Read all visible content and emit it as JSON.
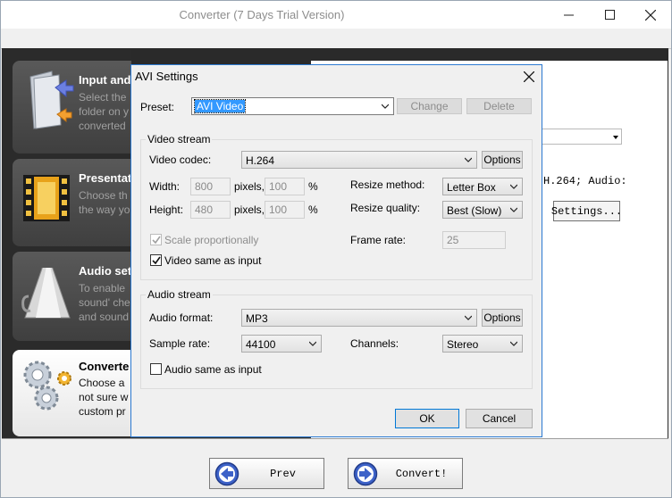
{
  "app": {
    "title": "Converter (7 Days Trial Version)"
  },
  "steps": [
    {
      "title": "Input and",
      "desc": [
        "Select the",
        "folder on y",
        "converted"
      ]
    },
    {
      "title": "Presentat",
      "desc": [
        "Choose th",
        "the way yo"
      ]
    },
    {
      "title": "Audio set",
      "desc": [
        "To enable",
        "sound' che",
        "and sound"
      ]
    },
    {
      "title": "Converte",
      "desc": [
        "Choose a",
        "not sure w",
        "custom pr"
      ]
    }
  ],
  "background": {
    "codec_text": "H.264; Audio:",
    "settings_label": "Settings..."
  },
  "nav": {
    "prev_label": "Prev",
    "convert_label": "Convert!"
  },
  "dialog": {
    "title": "AVI Settings",
    "preset_label": "Preset:",
    "preset_value": "AVI Video",
    "change_label": "Change",
    "delete_label": "Delete",
    "video": {
      "group_label": "Video stream",
      "codec_label": "Video codec:",
      "codec_value": "H.264",
      "options_label": "Options",
      "width_label": "Width:",
      "width_px": "800",
      "pixels_label1": "pixels,",
      "width_pct": "100",
      "pct1": "%",
      "height_label": "Height:",
      "height_px": "480",
      "pixels_label2": "pixels,",
      "height_pct": "100",
      "pct2": "%",
      "resize_method_label": "Resize method:",
      "resize_method_value": "Letter Box",
      "resize_quality_label": "Resize quality:",
      "resize_quality_value": "Best (Slow)",
      "scale_label": "Scale proportionally",
      "scale_checked": true,
      "same_label": "Video same as input",
      "same_checked": true,
      "frame_rate_label": "Frame rate:",
      "frame_rate_value": "25"
    },
    "audio": {
      "group_label": "Audio stream",
      "format_label": "Audio format:",
      "format_value": "MP3",
      "options_label": "Options",
      "sample_rate_label": "Sample rate:",
      "sample_rate_value": "44100",
      "channels_label": "Channels:",
      "channels_value": "Stereo",
      "same_label": "Audio same as input",
      "same_checked": false
    },
    "ok_label": "OK",
    "cancel_label": "Cancel"
  },
  "colors": {
    "accent": "#0078d7",
    "selection": "#3399ff"
  }
}
